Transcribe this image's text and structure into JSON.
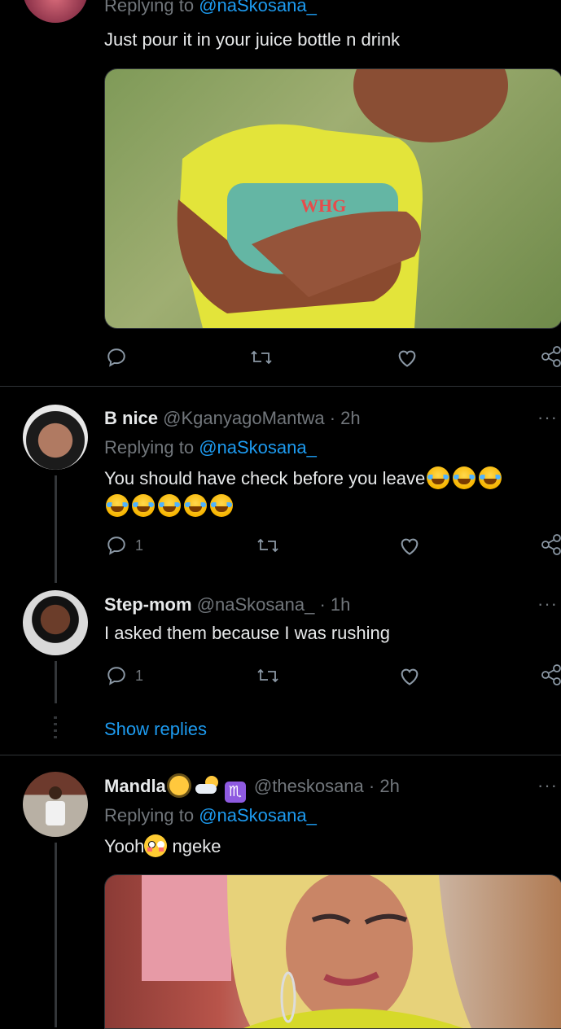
{
  "tweet0": {
    "replying_prefix": "Replying to",
    "replying_handle": "@naSkosana_",
    "text": "Just pour it in your juice bottle n drink",
    "actions": {
      "reply_count": "",
      "retweet_count": "",
      "like_count": ""
    }
  },
  "tweet1": {
    "name": "B nice",
    "handle": "@KganyagoMantwa",
    "time": "· 2h",
    "replying_prefix": "Replying to",
    "replying_handle": "@naSkosana_",
    "text": "You should have check before you leave",
    "emoji_count": 8,
    "actions": {
      "reply_count": "1"
    }
  },
  "tweet2": {
    "name": "Step-mom",
    "handle": "@naSkosana_",
    "time": "· 1h",
    "text": "I asked them because I was rushing",
    "actions": {
      "reply_count": "1"
    },
    "show_replies": "Show replies"
  },
  "tweet3": {
    "name": "Mandla",
    "handle": "@theskosana",
    "time": "· 2h",
    "replying_prefix": "Replying to",
    "replying_handle": "@naSkosana_",
    "text_before": "Yooh",
    "text_after": " ngeke"
  },
  "more_label": "···",
  "colors": {
    "background": "#000000",
    "text": "#e7e9ea",
    "muted": "#71767b",
    "accent": "#1d9bf0"
  }
}
